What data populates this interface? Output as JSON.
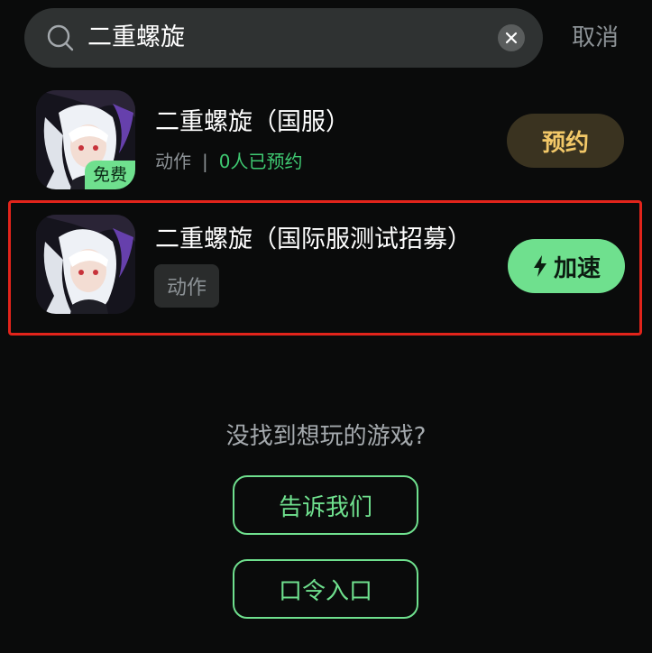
{
  "search": {
    "query": "二重螺旋",
    "cancel_label": "取消"
  },
  "results": [
    {
      "title": "二重螺旋（国服）",
      "badge": "免费",
      "genre": "动作",
      "separator": "|",
      "reservations": "0人已预约",
      "action_label": "预约"
    },
    {
      "title": "二重螺旋（国际服测试招募）",
      "genre": "动作",
      "action_label": "加速"
    }
  ],
  "footer": {
    "prompt": "没找到想玩的游戏?",
    "tell_us_label": "告诉我们",
    "code_entry_label": "口令入口"
  },
  "colors": {
    "background": "#0a0b0b",
    "accent_green": "#6fe08e",
    "reserve_gold": "#f2c868",
    "highlight_red": "#e2241b"
  }
}
